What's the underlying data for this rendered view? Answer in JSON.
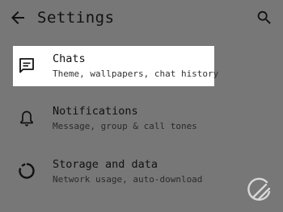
{
  "header": {
    "title": "Settings",
    "back_icon": "arrow-left-icon",
    "search_icon": "search-icon"
  },
  "items": [
    {
      "label": "Chats",
      "subtitle": "Theme, wallpapers, chat history",
      "icon": "chat-icon",
      "highlighted": true
    },
    {
      "label": "Notifications",
      "subtitle": "Message, group & call tones",
      "icon": "bell-icon",
      "highlighted": false
    },
    {
      "label": "Storage and data",
      "subtitle": "Network usage, auto-download",
      "icon": "data-usage-icon",
      "highlighted": false
    }
  ],
  "colors": {
    "background": "#777777",
    "highlight": "#ffffff",
    "text": "#111111"
  }
}
